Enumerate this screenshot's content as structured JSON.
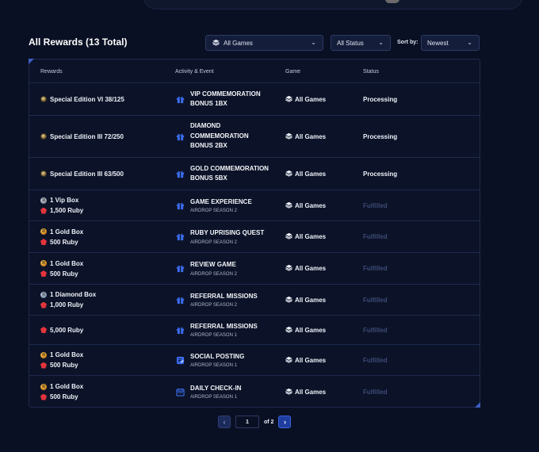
{
  "header": {
    "title": "All Rewards (13 Total)",
    "games_filter": "All Games",
    "status_filter": "All Status",
    "sort_label": "Sort by:",
    "sort_value": "Newest"
  },
  "table": {
    "columns": [
      "Rewards",
      "Activity & Event",
      "Game",
      "Status"
    ],
    "rows": [
      {
        "rewards": [
          {
            "icon": "coin-icon",
            "text": "Special Edition VI 38/125"
          }
        ],
        "activity_icon": "gift-icon",
        "activity": "VIP COMMEMORATION\nBONUS 1BX",
        "sub": "",
        "game": "All Games",
        "status": "Processing"
      },
      {
        "rewards": [
          {
            "icon": "coin-icon",
            "text": "Special Edition III 72/250"
          }
        ],
        "activity_icon": "gift-icon",
        "activity": "DIAMOND\nCOMMEMORATION\nBONUS 2BX",
        "sub": "",
        "game": "All Games",
        "status": "Processing"
      },
      {
        "rewards": [
          {
            "icon": "coin-icon",
            "text": "Special Edition III 63/500"
          }
        ],
        "activity_icon": "gift-icon",
        "activity": "GOLD COMMEMORATION\nBONUS 5BX",
        "sub": "",
        "game": "All Games",
        "status": "Processing"
      },
      {
        "rewards": [
          {
            "icon": "vip-box-icon",
            "text": "1 Vip Box"
          },
          {
            "icon": "ruby-icon",
            "text": "1,500 Ruby"
          }
        ],
        "activity_icon": "gift-icon",
        "activity": "GAME EXPERIENCE",
        "sub": "AIRDROP SEASON 2",
        "game": "All Games",
        "status": "Fulfilled"
      },
      {
        "rewards": [
          {
            "icon": "gold-box-icon",
            "text": "1 Gold Box"
          },
          {
            "icon": "ruby-icon",
            "text": "500 Ruby"
          }
        ],
        "activity_icon": "gift-icon",
        "activity": "RUBY UPRISING QUEST",
        "sub": "AIRDROP SEASON 2",
        "game": "All Games",
        "status": "Fulfilled"
      },
      {
        "rewards": [
          {
            "icon": "gold-box-icon",
            "text": "1 Gold Box"
          },
          {
            "icon": "ruby-icon",
            "text": "500 Ruby"
          }
        ],
        "activity_icon": "gift-icon",
        "activity": "REVIEW GAME",
        "sub": "AIRDROP SEASON 2",
        "game": "All Games",
        "status": "Fulfilled"
      },
      {
        "rewards": [
          {
            "icon": "diamond-box-icon",
            "text": "1 Diamond Box"
          },
          {
            "icon": "ruby-icon",
            "text": "1,000 Ruby"
          }
        ],
        "activity_icon": "gift-icon",
        "activity": "REFERRAL MISSIONS",
        "sub": "AIRDROP SEASON 2",
        "game": "All Games",
        "status": "Fulfilled"
      },
      {
        "rewards": [
          {
            "icon": "ruby-icon",
            "text": "5,000 Ruby"
          }
        ],
        "activity_icon": "gift-icon",
        "activity": "REFERRAL MISSIONS",
        "sub": "AIRDROP SEASON 1",
        "game": "All Games",
        "status": "Fulfilled"
      },
      {
        "rewards": [
          {
            "icon": "gold-box-icon",
            "text": "1 Gold Box"
          },
          {
            "icon": "ruby-icon",
            "text": "500 Ruby"
          }
        ],
        "activity_icon": "edit-note-icon",
        "activity": "SOCIAL POSTING",
        "sub": "AIRDROP SEASON 1",
        "game": "All Games",
        "status": "Fulfilled"
      },
      {
        "rewards": [
          {
            "icon": "gold-box-icon",
            "text": "1 Gold Box"
          },
          {
            "icon": "ruby-icon",
            "text": "500 Ruby"
          }
        ],
        "activity_icon": "calendar-icon",
        "activity": "DAILY CHECK-IN",
        "sub": "AIRDROP SEASON 1",
        "game": "All Games",
        "status": "Fulfilled"
      }
    ]
  },
  "pagination": {
    "current": "1",
    "of_label": "of 2"
  },
  "colors": {
    "background": "#0a1023",
    "accent": "#3a63e0",
    "fulfilled": "#3c4a74"
  }
}
